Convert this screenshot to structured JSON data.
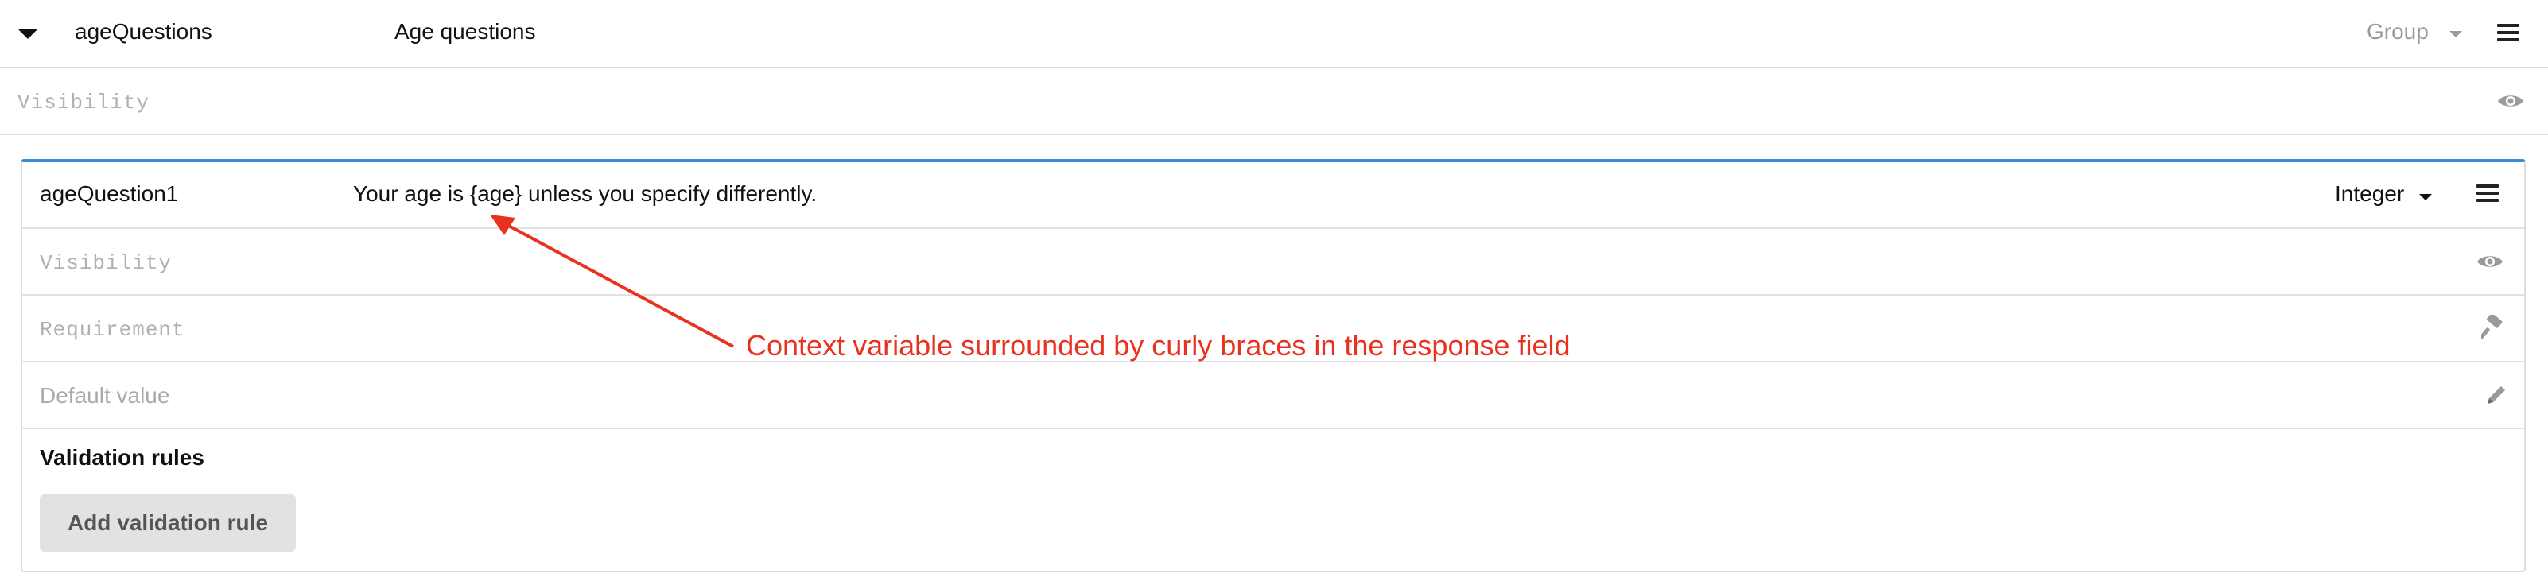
{
  "group": {
    "name": "ageQuestions",
    "label": "Age questions",
    "type": "Group",
    "visibility_placeholder": "Visibility"
  },
  "question": {
    "name": "ageQuestion1",
    "label": "Your age is {age} unless you specify differently.",
    "type": "Integer",
    "visibility_placeholder": "Visibility",
    "requirement_placeholder": "Requirement",
    "default_value_placeholder": "Default value",
    "validation_title": "Validation rules",
    "add_validation_label": "Add validation rule"
  },
  "annotation": {
    "text": "Context variable surrounded by curly braces in the response field",
    "color": "#e8321f"
  },
  "icons": [
    "caret-down-icon",
    "hamburger-menu-icon",
    "eye-icon",
    "gavel-icon",
    "pencil-icon"
  ],
  "colors": {
    "accent": "#3b8dd1",
    "annotation": "#e8321f"
  }
}
